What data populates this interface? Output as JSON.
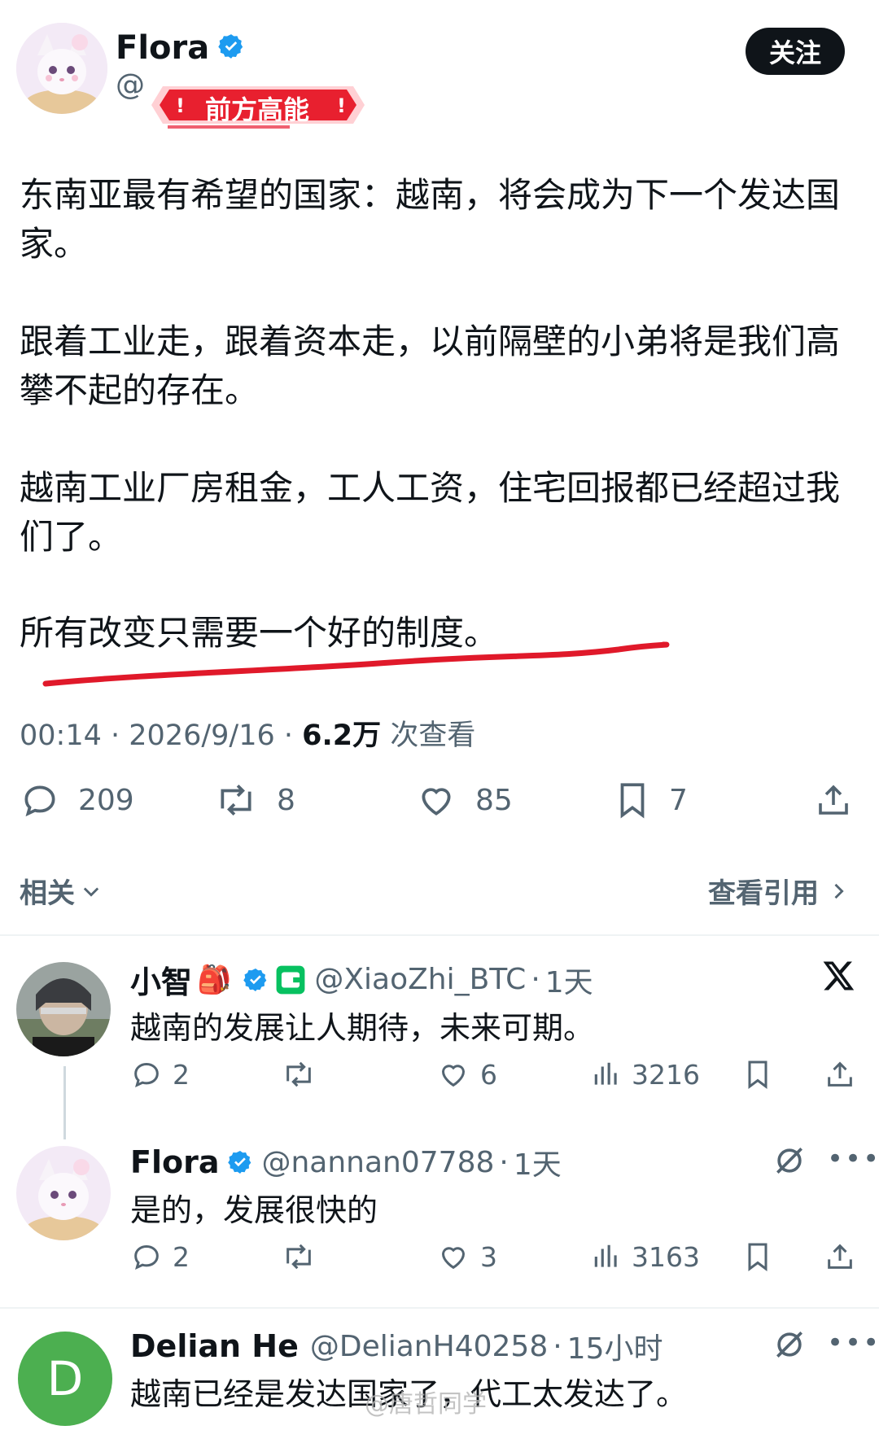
{
  "post": {
    "author_name": "Flora",
    "handle_prefix": "@",
    "badge_text": "前方高能",
    "follow_label": "关注",
    "paragraphs": [
      "东南亚最有希望的国家：越南，将会成为下一个发达国家。",
      "跟着工业走，跟着资本走，以前隔壁的小弟将是我们高攀不起的存在。",
      "越南工业厂房租金，工人工资，住宅回报都已经超过我们了。",
      "所有改变只需要一个好的制度。"
    ],
    "time": "00:14",
    "date": "2026/9/16",
    "views_count": "6.2万",
    "views_label": "次查看",
    "stats": {
      "replies": "209",
      "reposts": "8",
      "likes": "85",
      "bookmarks": "7"
    }
  },
  "links": {
    "related": "相关",
    "view_quotes": "查看引用"
  },
  "replies": [
    {
      "name": "小智",
      "emoji": "🎒",
      "handle": "@XiaoZhi_BTC",
      "time": "1天",
      "text": "越南的发展让人期待，未来可期。",
      "stats": {
        "replies": "2",
        "likes": "6",
        "views": "3216"
      }
    },
    {
      "name": "Flora",
      "handle": "@nannan07788",
      "time": "1天",
      "text": "是的，发展很快的",
      "stats": {
        "replies": "2",
        "likes": "3",
        "views": "3163"
      }
    },
    {
      "name": "Delian He",
      "avatar_letter": "D",
      "handle": "@DelianH40258",
      "time": "15小时",
      "text": "越南已经是发达国家了，代工太发达了。"
    }
  ],
  "watermark": "@唐哲同学",
  "colors": {
    "verified_blue": "#1d9bf0",
    "text_primary": "#0f1419",
    "text_secondary": "#536471",
    "underline_red": "#e0192a",
    "badge_red": "#e8202f",
    "delian_avatar_green": "#4caf50"
  }
}
